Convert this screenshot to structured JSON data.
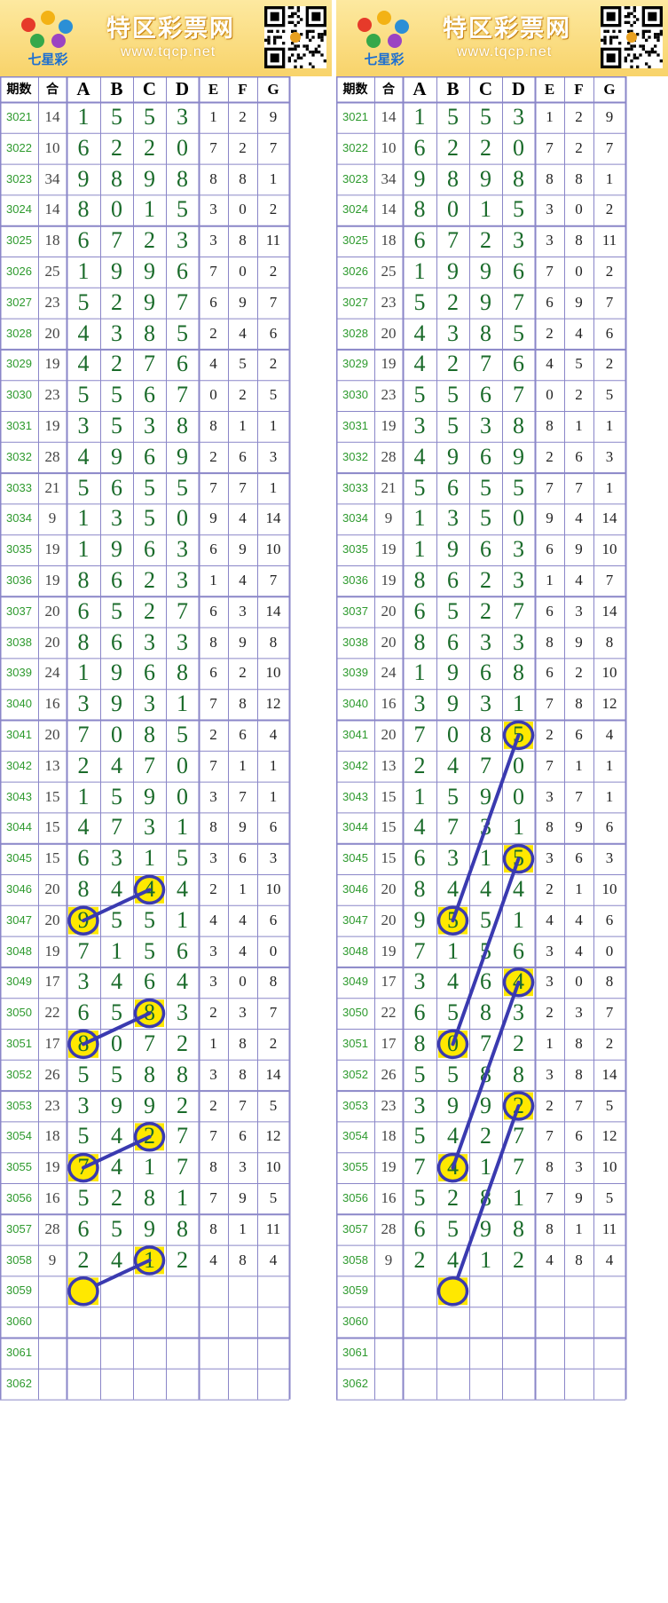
{
  "site": {
    "name": "特区彩票网",
    "url": "www.tqcp.net",
    "logo_text": "七星彩"
  },
  "columns": [
    "期数",
    "合",
    "A",
    "B",
    "C",
    "D",
    "E",
    "F",
    "G"
  ],
  "colors": {
    "grid": "#8a86c8",
    "main_digit": "#1a6b2a",
    "period": "#2e9a2e",
    "highlight": "#ffe800",
    "ring": "#3a3ab0",
    "header_bg": "#f8d36a"
  },
  "chart_data": {
    "type": "table",
    "rows": [
      {
        "period": "3021",
        "sum": "14",
        "digits": [
          "1",
          "5",
          "5",
          "3"
        ],
        "extra": [
          "1",
          "2",
          "9"
        ]
      },
      {
        "period": "3022",
        "sum": "10",
        "digits": [
          "6",
          "2",
          "2",
          "0"
        ],
        "extra": [
          "7",
          "2",
          "7"
        ]
      },
      {
        "period": "3023",
        "sum": "34",
        "digits": [
          "9",
          "8",
          "9",
          "8"
        ],
        "extra": [
          "8",
          "8",
          "1"
        ]
      },
      {
        "period": "3024",
        "sum": "14",
        "digits": [
          "8",
          "0",
          "1",
          "5"
        ],
        "extra": [
          "3",
          "0",
          "2"
        ]
      },
      {
        "period": "3025",
        "sum": "18",
        "digits": [
          "6",
          "7",
          "2",
          "3"
        ],
        "extra": [
          "3",
          "8",
          "11"
        ]
      },
      {
        "period": "3026",
        "sum": "25",
        "digits": [
          "1",
          "9",
          "9",
          "6"
        ],
        "extra": [
          "7",
          "0",
          "2"
        ]
      },
      {
        "period": "3027",
        "sum": "23",
        "digits": [
          "5",
          "2",
          "9",
          "7"
        ],
        "extra": [
          "6",
          "9",
          "7"
        ]
      },
      {
        "period": "3028",
        "sum": "20",
        "digits": [
          "4",
          "3",
          "8",
          "5"
        ],
        "extra": [
          "2",
          "4",
          "6"
        ]
      },
      {
        "period": "3029",
        "sum": "19",
        "digits": [
          "4",
          "2",
          "7",
          "6"
        ],
        "extra": [
          "4",
          "5",
          "2"
        ]
      },
      {
        "period": "3030",
        "sum": "23",
        "digits": [
          "5",
          "5",
          "6",
          "7"
        ],
        "extra": [
          "0",
          "2",
          "5"
        ]
      },
      {
        "period": "3031",
        "sum": "19",
        "digits": [
          "3",
          "5",
          "3",
          "8"
        ],
        "extra": [
          "8",
          "1",
          "1"
        ]
      },
      {
        "period": "3032",
        "sum": "28",
        "digits": [
          "4",
          "9",
          "6",
          "9"
        ],
        "extra": [
          "2",
          "6",
          "3"
        ]
      },
      {
        "period": "3033",
        "sum": "21",
        "digits": [
          "5",
          "6",
          "5",
          "5"
        ],
        "extra": [
          "7",
          "7",
          "1"
        ]
      },
      {
        "period": "3034",
        "sum": "9",
        "digits": [
          "1",
          "3",
          "5",
          "0"
        ],
        "extra": [
          "9",
          "4",
          "14"
        ]
      },
      {
        "period": "3035",
        "sum": "19",
        "digits": [
          "1",
          "9",
          "6",
          "3"
        ],
        "extra": [
          "6",
          "9",
          "10"
        ]
      },
      {
        "period": "3036",
        "sum": "19",
        "digits": [
          "8",
          "6",
          "2",
          "3"
        ],
        "extra": [
          "1",
          "4",
          "7"
        ]
      },
      {
        "period": "3037",
        "sum": "20",
        "digits": [
          "6",
          "5",
          "2",
          "7"
        ],
        "extra": [
          "6",
          "3",
          "14"
        ]
      },
      {
        "period": "3038",
        "sum": "20",
        "digits": [
          "8",
          "6",
          "3",
          "3"
        ],
        "extra": [
          "8",
          "9",
          "8"
        ]
      },
      {
        "period": "3039",
        "sum": "24",
        "digits": [
          "1",
          "9",
          "6",
          "8"
        ],
        "extra": [
          "6",
          "2",
          "10"
        ]
      },
      {
        "period": "3040",
        "sum": "16",
        "digits": [
          "3",
          "9",
          "3",
          "1"
        ],
        "extra": [
          "7",
          "8",
          "12"
        ]
      },
      {
        "period": "3041",
        "sum": "20",
        "digits": [
          "7",
          "0",
          "8",
          "5"
        ],
        "extra": [
          "2",
          "6",
          "4"
        ]
      },
      {
        "period": "3042",
        "sum": "13",
        "digits": [
          "2",
          "4",
          "7",
          "0"
        ],
        "extra": [
          "7",
          "1",
          "1"
        ]
      },
      {
        "period": "3043",
        "sum": "15",
        "digits": [
          "1",
          "5",
          "9",
          "0"
        ],
        "extra": [
          "3",
          "7",
          "1"
        ]
      },
      {
        "period": "3044",
        "sum": "15",
        "digits": [
          "4",
          "7",
          "3",
          "1"
        ],
        "extra": [
          "8",
          "9",
          "6"
        ]
      },
      {
        "period": "3045",
        "sum": "15",
        "digits": [
          "6",
          "3",
          "1",
          "5"
        ],
        "extra": [
          "3",
          "6",
          "3"
        ]
      },
      {
        "period": "3046",
        "sum": "20",
        "digits": [
          "8",
          "4",
          "4",
          "4"
        ],
        "extra": [
          "2",
          "1",
          "10"
        ]
      },
      {
        "period": "3047",
        "sum": "20",
        "digits": [
          "9",
          "5",
          "5",
          "1"
        ],
        "extra": [
          "4",
          "4",
          "6"
        ]
      },
      {
        "period": "3048",
        "sum": "19",
        "digits": [
          "7",
          "1",
          "5",
          "6"
        ],
        "extra": [
          "3",
          "4",
          "0"
        ]
      },
      {
        "period": "3049",
        "sum": "17",
        "digits": [
          "3",
          "4",
          "6",
          "4"
        ],
        "extra": [
          "3",
          "0",
          "8"
        ]
      },
      {
        "period": "3050",
        "sum": "22",
        "digits": [
          "6",
          "5",
          "8",
          "3"
        ],
        "extra": [
          "2",
          "3",
          "7"
        ]
      },
      {
        "period": "3051",
        "sum": "17",
        "digits": [
          "8",
          "0",
          "7",
          "2"
        ],
        "extra": [
          "1",
          "8",
          "2"
        ]
      },
      {
        "period": "3052",
        "sum": "26",
        "digits": [
          "5",
          "5",
          "8",
          "8"
        ],
        "extra": [
          "3",
          "8",
          "14"
        ]
      },
      {
        "period": "3053",
        "sum": "23",
        "digits": [
          "3",
          "9",
          "9",
          "2"
        ],
        "extra": [
          "2",
          "7",
          "5"
        ]
      },
      {
        "period": "3054",
        "sum": "18",
        "digits": [
          "5",
          "4",
          "2",
          "7"
        ],
        "extra": [
          "7",
          "6",
          "12"
        ]
      },
      {
        "period": "3055",
        "sum": "19",
        "digits": [
          "7",
          "4",
          "1",
          "7"
        ],
        "extra": [
          "8",
          "3",
          "10"
        ]
      },
      {
        "period": "3056",
        "sum": "16",
        "digits": [
          "5",
          "2",
          "8",
          "1"
        ],
        "extra": [
          "7",
          "9",
          "5"
        ]
      },
      {
        "period": "3057",
        "sum": "28",
        "digits": [
          "6",
          "5",
          "9",
          "8"
        ],
        "extra": [
          "8",
          "1",
          "11"
        ]
      },
      {
        "period": "3058",
        "sum": "9",
        "digits": [
          "2",
          "4",
          "1",
          "2"
        ],
        "extra": [
          "4",
          "8",
          "4"
        ]
      },
      {
        "period": "3059",
        "sum": "",
        "digits": [
          "",
          "",
          "",
          ""
        ],
        "extra": [
          "",
          "",
          ""
        ]
      },
      {
        "period": "3060",
        "sum": "",
        "digits": [
          "",
          "",
          "",
          ""
        ],
        "extra": [
          "",
          "",
          ""
        ]
      },
      {
        "period": "3061",
        "sum": "",
        "digits": [
          "",
          "",
          "",
          ""
        ],
        "extra": [
          "",
          "",
          ""
        ]
      },
      {
        "period": "3062",
        "sum": "",
        "digits": [
          "",
          "",
          "",
          ""
        ],
        "extra": [
          "",
          "",
          ""
        ]
      }
    ],
    "left_marks": [
      {
        "period": "3046",
        "col": "C"
      },
      {
        "period": "3047",
        "col": "A"
      },
      {
        "period": "3050",
        "col": "C"
      },
      {
        "period": "3051",
        "col": "A"
      },
      {
        "period": "3054",
        "col": "C"
      },
      {
        "period": "3055",
        "col": "A"
      },
      {
        "period": "3058",
        "col": "C"
      },
      {
        "period": "3059",
        "col": "A"
      }
    ],
    "left_lines": [
      [
        {
          "period": "3046",
          "col": "C"
        },
        {
          "period": "3047",
          "col": "A"
        }
      ],
      [
        {
          "period": "3050",
          "col": "C"
        },
        {
          "period": "3051",
          "col": "A"
        }
      ],
      [
        {
          "period": "3054",
          "col": "C"
        },
        {
          "period": "3055",
          "col": "A"
        }
      ],
      [
        {
          "period": "3058",
          "col": "C"
        },
        {
          "period": "3059",
          "col": "A"
        }
      ]
    ],
    "right_marks": [
      {
        "period": "3041",
        "col": "D"
      },
      {
        "period": "3045",
        "col": "D"
      },
      {
        "period": "3047",
        "col": "B"
      },
      {
        "period": "3049",
        "col": "D"
      },
      {
        "period": "3051",
        "col": "B"
      },
      {
        "period": "3053",
        "col": "D"
      },
      {
        "period": "3055",
        "col": "B"
      },
      {
        "period": "3059",
        "col": "B"
      }
    ],
    "right_lines": [
      [
        {
          "period": "3041",
          "col": "D"
        },
        {
          "period": "3047",
          "col": "B"
        }
      ],
      [
        {
          "period": "3045",
          "col": "D"
        },
        {
          "period": "3051",
          "col": "B"
        }
      ],
      [
        {
          "period": "3049",
          "col": "D"
        },
        {
          "period": "3055",
          "col": "B"
        }
      ],
      [
        {
          "period": "3053",
          "col": "D"
        },
        {
          "period": "3059",
          "col": "B"
        }
      ]
    ]
  }
}
